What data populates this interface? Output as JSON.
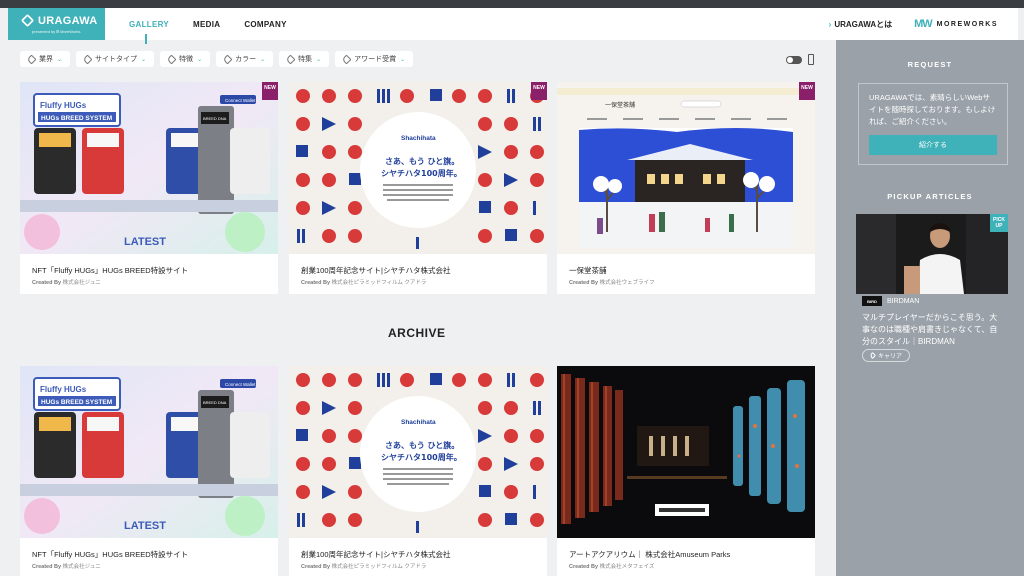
{
  "brand": {
    "name": "URAGAWA",
    "sub": "presented by Ⅲ MoreWorks"
  },
  "nav": {
    "items": [
      "GALLERY",
      "MEDIA",
      "COMPANY"
    ],
    "active": "GALLERY",
    "about_link": "URAGAWAとは",
    "partner_logo": "MOREWORKS"
  },
  "filters": [
    {
      "label": "業界",
      "icon": "tag-icon"
    },
    {
      "label": "サイトタイプ",
      "icon": "tag-icon"
    },
    {
      "label": "特徴",
      "icon": "tag-icon"
    },
    {
      "label": "カラー",
      "icon": "tag-icon"
    },
    {
      "label": "特集",
      "icon": "tag-icon"
    },
    {
      "label": "アワード受賞",
      "icon": "tag-icon"
    }
  ],
  "featured": [
    {
      "title": "NFT「Fluffy HUGs」HUGs BREED特設サイト",
      "credit_prefix": "Created By",
      "credit": "株式会社ジュニ",
      "badge": "NEW",
      "thumb_text": {
        "heading_1": "Fluffy HUGs",
        "heading_2": "HUGs BREED SYSTEM",
        "button": "Connect Wallet",
        "machine": "BREED DNA",
        "footer": "LATEST"
      }
    },
    {
      "title": "創業100周年記念サイト|シヤチハタ株式会社",
      "credit_prefix": "Created By",
      "credit": "株式会社ピラミッドフィルム クアドラ",
      "badge": "NEW",
      "thumb_text": {
        "logo": "Shachihata",
        "line_1": "さあ、もう ひと旗。",
        "line_2": "シヤチハタ100周年。"
      }
    },
    {
      "title": "一保堂茶舗",
      "credit_prefix": "Created By",
      "credit": "株式会社ウェブライフ",
      "badge": "NEW",
      "thumb_text": {
        "logo": "一保堂茶舗"
      }
    }
  ],
  "archive_title": "ARCHIVE",
  "archive": [
    {
      "title": "NFT「Fluffy HUGs」HUGs BREED特設サイト",
      "credit_prefix": "Created By",
      "credit": "株式会社ジュニ",
      "thumb_text": {
        "heading_1": "Fluffy HUGs",
        "heading_2": "HUGs BREED SYSTEM",
        "button": "Connect Wallet",
        "machine": "BREED DNA",
        "footer": "LATEST"
      }
    },
    {
      "title": "創業100周年記念サイト|シヤチハタ株式会社",
      "credit_prefix": "Created By",
      "credit": "株式会社ピラミッドフィルム クアドラ",
      "thumb_text": {
        "logo": "Shachihata",
        "line_1": "さあ、もう ひと旗。",
        "line_2": "シヤチハタ100周年。"
      }
    },
    {
      "title": "アートアクアリウム｜ 株式会社Amuseum Parks",
      "credit_prefix": "Created By",
      "credit": "株式会社メタフェイズ"
    }
  ],
  "sidebar": {
    "request_heading": "REQUEST",
    "request_text": "URAGAWAでは、素晴らしいWebサイトを随時探しております。もしよければ、ご紹介ください。",
    "request_button": "紹介する",
    "pickup_heading": "PICKUP ARTICLES",
    "pickup_badge": "PICK UP",
    "article_brand": "BIRDMAN",
    "article_title": "マルチプレイヤーだからこそ思う。大事なのは職種や肩書きじゃなくて、自分のスタイル｜BIRDMAN",
    "article_tag": "キャリア"
  },
  "colors": {
    "accent": "#3fb1b8",
    "new_badge": "#8a1f6a",
    "sidebar_bg": "#9aa1a8",
    "page_bg": "#eef0f2"
  }
}
